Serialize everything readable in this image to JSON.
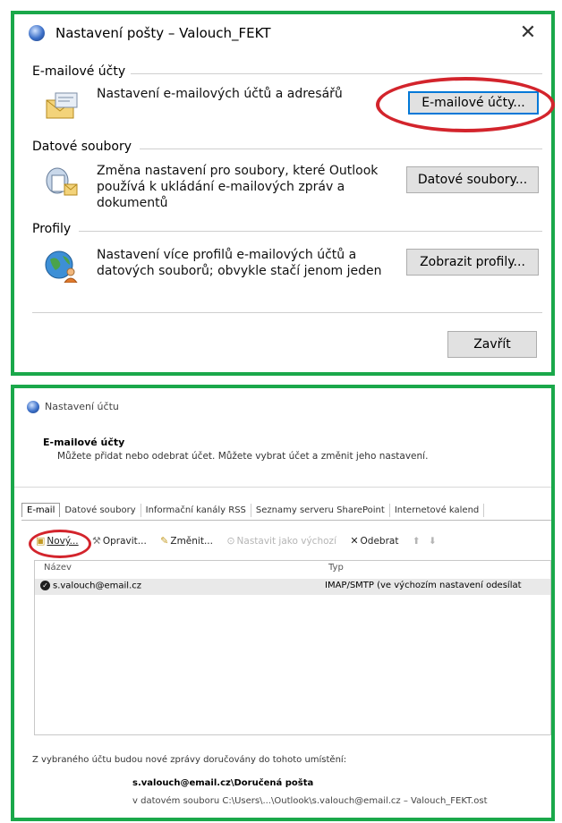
{
  "dialog1": {
    "title": "Nastavení pošty – Valouch_FEKT",
    "close_glyph": "✕",
    "sections": [
      {
        "heading": "E-mailové účty",
        "description": "Nastavení e-mailových účtů a adresářů",
        "button": "E-mailové účty...",
        "icon": "envelope-icon"
      },
      {
        "heading": "Datové soubory",
        "description": "Změna nastavení pro soubory, které Outlook používá k ukládání e-mailových zpráv a dokumentů",
        "button": "Datové soubory...",
        "icon": "data-files-icon"
      },
      {
        "heading": "Profily",
        "description": "Nastavení více profilů e-mailových účtů a datových souborů; obvykle stačí jenom jeden",
        "button": "Zobrazit profily...",
        "icon": "profiles-globe-icon"
      }
    ],
    "close_button": "Zavřít",
    "highlight_color": "#d3242c",
    "frame_color": "#1aa84a"
  },
  "dialog2": {
    "title": "Nastavení účtu",
    "header_title": "E-mailové účty",
    "header_desc": "Můžete přidat nebo odebrat účet. Můžete vybrat účet a změnit jeho nastavení.",
    "tabs": [
      "E-mail",
      "Datové soubory",
      "Informační kanály RSS",
      "Seznamy serveru SharePoint",
      "Internetové kalend"
    ],
    "toolbar": {
      "new": "Nový...",
      "repair": "Opravit...",
      "change": "Změnit...",
      "set_default": "Nastavit jako výchozí",
      "remove": "Odebrat"
    },
    "columns": [
      "Název",
      "Typ"
    ],
    "rows": [
      {
        "name": "s.valouch@email.cz",
        "type": "IMAP/SMTP (ve výchozím nastavení odesílat"
      }
    ],
    "deliver_label": "Z vybraného účtu budou nové zprávy doručovány do tohoto umístění:",
    "deliver_folder": "s.valouch@email.cz\\Doručená pošta",
    "deliver_file": "v datovém souboru C:\\Users\\...\\Outlook\\s.valouch@email.cz – Valouch_FEKT.ost"
  }
}
